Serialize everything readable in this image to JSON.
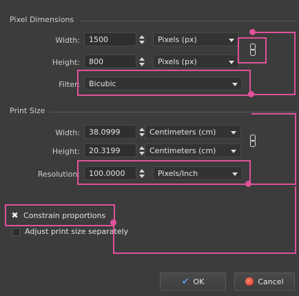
{
  "pixel_dimensions": {
    "title": "Pixel Dimensions",
    "width": {
      "label": "Width:",
      "value": "1500",
      "unit": "Pixels (px)"
    },
    "height": {
      "label": "Height:",
      "value": "800",
      "unit": "Pixels (px)"
    },
    "filter": {
      "label": "Filter:",
      "value": "Bicubic"
    }
  },
  "print_size": {
    "title": "Print Size",
    "width": {
      "label": "Width:",
      "value": "38.0999",
      "unit": "Centimeters (cm)"
    },
    "height": {
      "label": "Height:",
      "value": "20.3199",
      "unit": "Centimeters (cm)"
    },
    "resolution": {
      "label": "Resolution:",
      "value": "100.0000",
      "unit": "Pixels/Inch"
    }
  },
  "options": {
    "constrain": {
      "label": "Constrain proportions",
      "checked": true
    },
    "adjust_print": {
      "label": "Adjust print size separately",
      "checked": false
    }
  },
  "buttons": {
    "ok": "OK",
    "cancel": "Cancel"
  },
  "colors": {
    "annotation": "#e0529b",
    "background": "#3c3c3c"
  }
}
